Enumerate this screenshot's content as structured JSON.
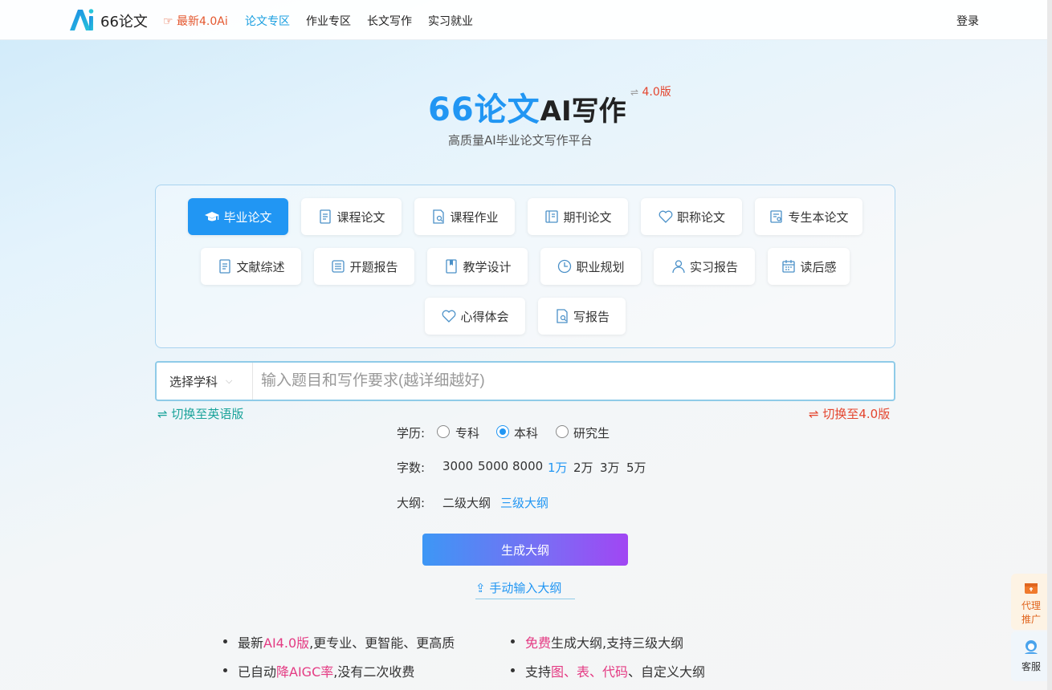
{
  "header": {
    "brand": "66论文",
    "nav": [
      {
        "label": "最新4.0Ai"
      },
      {
        "label": "论文专区"
      },
      {
        "label": "作业专区"
      },
      {
        "label": "长文写作"
      },
      {
        "label": "实习就业"
      }
    ],
    "login": "登录"
  },
  "hero": {
    "title_main": "66论文",
    "title_rest": "AI写作",
    "version_switch": "⇌",
    "version": "4.0版",
    "subtitle": "高质量AI毕业论文写作平台"
  },
  "types": [
    {
      "label": "毕业论文",
      "icon": "graduation-cap-icon",
      "selected": true
    },
    {
      "label": "课程论文",
      "icon": "document-icon"
    },
    {
      "label": "课程作业",
      "icon": "document-search-icon"
    },
    {
      "label": "期刊论文",
      "icon": "journal-icon"
    },
    {
      "label": "职称论文",
      "icon": "heart-icon"
    },
    {
      "label": "专生本论文",
      "icon": "report-icon"
    },
    {
      "label": "文献综述",
      "icon": "document-icon"
    },
    {
      "label": "开题报告",
      "icon": "list-icon"
    },
    {
      "label": "教学设计",
      "icon": "book-icon"
    },
    {
      "label": "职业规划",
      "icon": "clock-icon"
    },
    {
      "label": "实习报告",
      "icon": "user-icon"
    },
    {
      "label": "读后感",
      "icon": "calendar-icon"
    },
    {
      "label": "心得体会",
      "icon": "heart-icon"
    },
    {
      "label": "写报告",
      "icon": "document-search-icon"
    }
  ],
  "input": {
    "subject_label": "选择学科",
    "placeholder": "输入题目和写作要求(越详细越好)",
    "switch_english": "⇌ 切换至英语版",
    "switch_40": "⇌ 切换至4.0版"
  },
  "education": {
    "label": "学历:",
    "options": [
      "专科",
      "本科",
      "研究生"
    ],
    "selected": "本科"
  },
  "wordcount": {
    "label": "字数:",
    "options": [
      "3000",
      "5000",
      "8000",
      "1万",
      "2万",
      "3万",
      "5万"
    ],
    "selected": "1万"
  },
  "outline": {
    "label": "大纲:",
    "options": [
      "二级大纲",
      "三级大纲"
    ],
    "selected": "三级大纲"
  },
  "generate_button": "生成大纲",
  "manual_link": "手动输入大纲",
  "features": [
    {
      "pre": "最新",
      "hl": "AI4.0版",
      "post": ",更专业、更智能、更高质"
    },
    {
      "pre": "已自动",
      "hl": "降AIGC率",
      "post": ",没有二次收费"
    },
    {
      "pre": "",
      "hl": "免费",
      "post": "生成大纲,支持三级大纲"
    },
    {
      "pre": "支持",
      "hl": "图、表、代码",
      "post": "、自定义大纲"
    }
  ],
  "floaters": {
    "agent_line1": "代理",
    "agent_line2": "推广",
    "service": "客服"
  },
  "colors": {
    "accent": "#2196f3",
    "promo": "#e4572e",
    "teal": "#1aa39a",
    "highlight": "#e43b83"
  }
}
